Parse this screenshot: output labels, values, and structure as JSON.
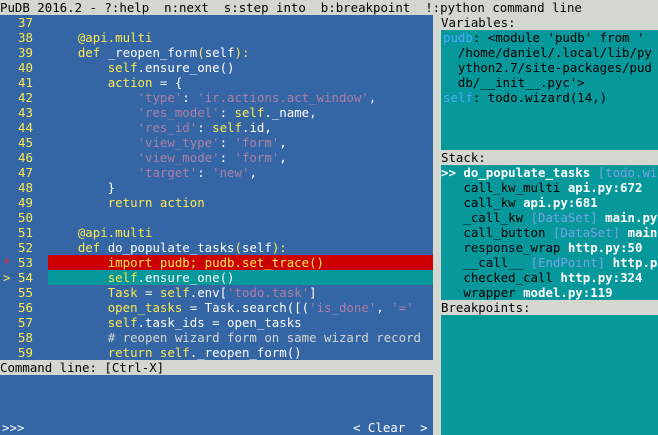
{
  "title_bar": "PuDB 2016.2 - ?:help  n:next  s:step into  b:breakpoint  !:python command line",
  "colors": {
    "code_bg": "#3465a4",
    "panel_bg": "#06989a",
    "header_bg": "#d3d7cf",
    "breakpoint_line_bg": "#cc0000",
    "keyword": "#fce94f",
    "string": "#ad7fa8",
    "comment": "#d3d7cf"
  },
  "code": {
    "lines": [
      {
        "num": "37",
        "marker": " ",
        "state": "normal",
        "tokens": []
      },
      {
        "num": "38",
        "marker": " ",
        "state": "normal",
        "tokens": [
          [
            "w",
            "    "
          ],
          [
            "y",
            "@api.multi"
          ]
        ]
      },
      {
        "num": "39",
        "marker": " ",
        "state": "normal",
        "tokens": [
          [
            "w",
            "    "
          ],
          [
            "y",
            "def "
          ],
          [
            "w",
            "_reopen_form"
          ],
          [
            "y",
            "("
          ],
          [
            "w",
            "self"
          ],
          [
            "y",
            "):"
          ]
        ]
      },
      {
        "num": "40",
        "marker": " ",
        "state": "normal",
        "tokens": [
          [
            "w",
            "        "
          ],
          [
            "y",
            "self"
          ],
          [
            "w",
            ".ensure_one()"
          ]
        ]
      },
      {
        "num": "41",
        "marker": " ",
        "state": "normal",
        "tokens": [
          [
            "w",
            "        "
          ],
          [
            "y",
            "action "
          ],
          [
            "w",
            "= {"
          ]
        ]
      },
      {
        "num": "42",
        "marker": " ",
        "state": "normal",
        "tokens": [
          [
            "w",
            "            "
          ],
          [
            "p",
            "'type'"
          ],
          [
            "w",
            ": "
          ],
          [
            "p",
            "'ir.actions.act_window'"
          ],
          [
            "w",
            ","
          ]
        ]
      },
      {
        "num": "43",
        "marker": " ",
        "state": "normal",
        "tokens": [
          [
            "w",
            "            "
          ],
          [
            "p",
            "'res_model'"
          ],
          [
            "w",
            ": "
          ],
          [
            "y",
            "self"
          ],
          [
            "w",
            "._name,"
          ]
        ]
      },
      {
        "num": "44",
        "marker": " ",
        "state": "normal",
        "tokens": [
          [
            "w",
            "            "
          ],
          [
            "p",
            "'res_id'"
          ],
          [
            "w",
            ": "
          ],
          [
            "y",
            "self"
          ],
          [
            "w",
            ".id,"
          ]
        ]
      },
      {
        "num": "45",
        "marker": " ",
        "state": "normal",
        "tokens": [
          [
            "w",
            "            "
          ],
          [
            "p",
            "'view_type'"
          ],
          [
            "w",
            ": "
          ],
          [
            "p",
            "'form'"
          ],
          [
            "w",
            ","
          ]
        ]
      },
      {
        "num": "46",
        "marker": " ",
        "state": "normal",
        "tokens": [
          [
            "w",
            "            "
          ],
          [
            "p",
            "'view_mode'"
          ],
          [
            "w",
            ": "
          ],
          [
            "p",
            "'form'"
          ],
          [
            "w",
            ","
          ]
        ]
      },
      {
        "num": "47",
        "marker": " ",
        "state": "normal",
        "tokens": [
          [
            "w",
            "            "
          ],
          [
            "p",
            "'target'"
          ],
          [
            "w",
            ": "
          ],
          [
            "p",
            "'new'"
          ],
          [
            "w",
            ","
          ]
        ]
      },
      {
        "num": "48",
        "marker": " ",
        "state": "normal",
        "tokens": [
          [
            "w",
            "        }"
          ]
        ]
      },
      {
        "num": "49",
        "marker": " ",
        "state": "normal",
        "tokens": [
          [
            "w",
            "        "
          ],
          [
            "y",
            "return action"
          ]
        ]
      },
      {
        "num": "50",
        "marker": " ",
        "state": "normal",
        "tokens": []
      },
      {
        "num": "51",
        "marker": " ",
        "state": "normal",
        "tokens": [
          [
            "w",
            "    "
          ],
          [
            "y",
            "@api.multi"
          ]
        ]
      },
      {
        "num": "52",
        "marker": " ",
        "state": "normal",
        "tokens": [
          [
            "w",
            "    "
          ],
          [
            "y",
            "def "
          ],
          [
            "w",
            "do_populate_tasks"
          ],
          [
            "y",
            "("
          ],
          [
            "w",
            "self"
          ],
          [
            "y",
            "):"
          ]
        ]
      },
      {
        "num": "53",
        "marker": "*",
        "state": "breakpoint",
        "tokens": [
          [
            "w",
            "        "
          ],
          [
            "y",
            "import pudb; pudb.set_trace()"
          ]
        ]
      },
      {
        "num": "54",
        "marker": ">",
        "state": "current",
        "tokens": [
          [
            "w",
            "        "
          ],
          [
            "y",
            "self"
          ],
          [
            "w",
            ".ensure_one()"
          ]
        ]
      },
      {
        "num": "55",
        "marker": " ",
        "state": "normal",
        "tokens": [
          [
            "w",
            "        "
          ],
          [
            "y",
            "Task "
          ],
          [
            "w",
            "= "
          ],
          [
            "y",
            "self"
          ],
          [
            "w",
            ".env["
          ],
          [
            "p",
            "'todo.task'"
          ],
          [
            "w",
            "]"
          ]
        ]
      },
      {
        "num": "56",
        "marker": " ",
        "state": "normal",
        "tokens": [
          [
            "w",
            "        "
          ],
          [
            "y",
            "open_tasks "
          ],
          [
            "w",
            "= Task.search([("
          ],
          [
            "p",
            "'is_done'"
          ],
          [
            "w",
            ", "
          ],
          [
            "p",
            "'='"
          ]
        ]
      },
      {
        "num": "57",
        "marker": " ",
        "state": "normal",
        "tokens": [
          [
            "w",
            "        "
          ],
          [
            "y",
            "self"
          ],
          [
            "w",
            ".task_ids = open_tasks"
          ]
        ]
      },
      {
        "num": "58",
        "marker": " ",
        "state": "normal",
        "tokens": [
          [
            "w",
            "        "
          ],
          [
            "c",
            "# reopen wizard form on same wizard record"
          ]
        ]
      },
      {
        "num": "59",
        "marker": " ",
        "state": "normal",
        "tokens": [
          [
            "w",
            "        "
          ],
          [
            "y",
            "return "
          ],
          [
            "y",
            "self"
          ],
          [
            "w",
            "._reopen_form()"
          ]
        ]
      }
    ]
  },
  "command_line": {
    "label": "Command line: [Ctrl-X]",
    "prompt": ">>>",
    "clear_button": "< Clear  >"
  },
  "variables": {
    "header": "Variables:",
    "lines": [
      [
        [
          "d",
          "pudb"
        ],
        [
          "k",
          ": <module 'pudb' from '"
        ]
      ],
      [
        [
          "k",
          "  /home/daniel/.local/lib/py"
        ]
      ],
      [
        [
          "k",
          "  ython2.7/site-packages/pud"
        ]
      ],
      [
        [
          "k",
          "  db/__init__.pyc'>"
        ]
      ],
      [
        [
          "d",
          "self"
        ],
        [
          "k",
          ": todo.wizard(14,)"
        ]
      ]
    ]
  },
  "stack": {
    "header": "Stack:",
    "frames": [
      {
        "prefix": ">> ",
        "func": "do_populate_tasks",
        "cls": "[todo.wizard]",
        "loc": "",
        "current": true
      },
      {
        "prefix": "   ",
        "func": "call_kw_multi",
        "cls": "",
        "loc": "api.py:672",
        "current": false
      },
      {
        "prefix": "   ",
        "func": "call_kw",
        "cls": "",
        "loc": "api.py:681",
        "current": false
      },
      {
        "prefix": "   ",
        "func": "_call_kw",
        "cls": "[DataSet]",
        "loc": "main.py",
        "current": false
      },
      {
        "prefix": "   ",
        "func": "call_button",
        "cls": "[DataSet]",
        "loc": "main.py",
        "current": false
      },
      {
        "prefix": "   ",
        "func": "response_wrap",
        "cls": "",
        "loc": "http.py:50",
        "current": false
      },
      {
        "prefix": "   ",
        "func": "__call__",
        "cls": "[EndPoint]",
        "loc": "http.py",
        "current": false
      },
      {
        "prefix": "   ",
        "func": "checked_call",
        "cls": "",
        "loc": "http.py:324",
        "current": false
      },
      {
        "prefix": "   ",
        "func": "wrapper",
        "cls": "",
        "loc": "model.py:119",
        "current": false
      }
    ]
  },
  "breakpoints": {
    "header": "Breakpoints:",
    "items": []
  }
}
